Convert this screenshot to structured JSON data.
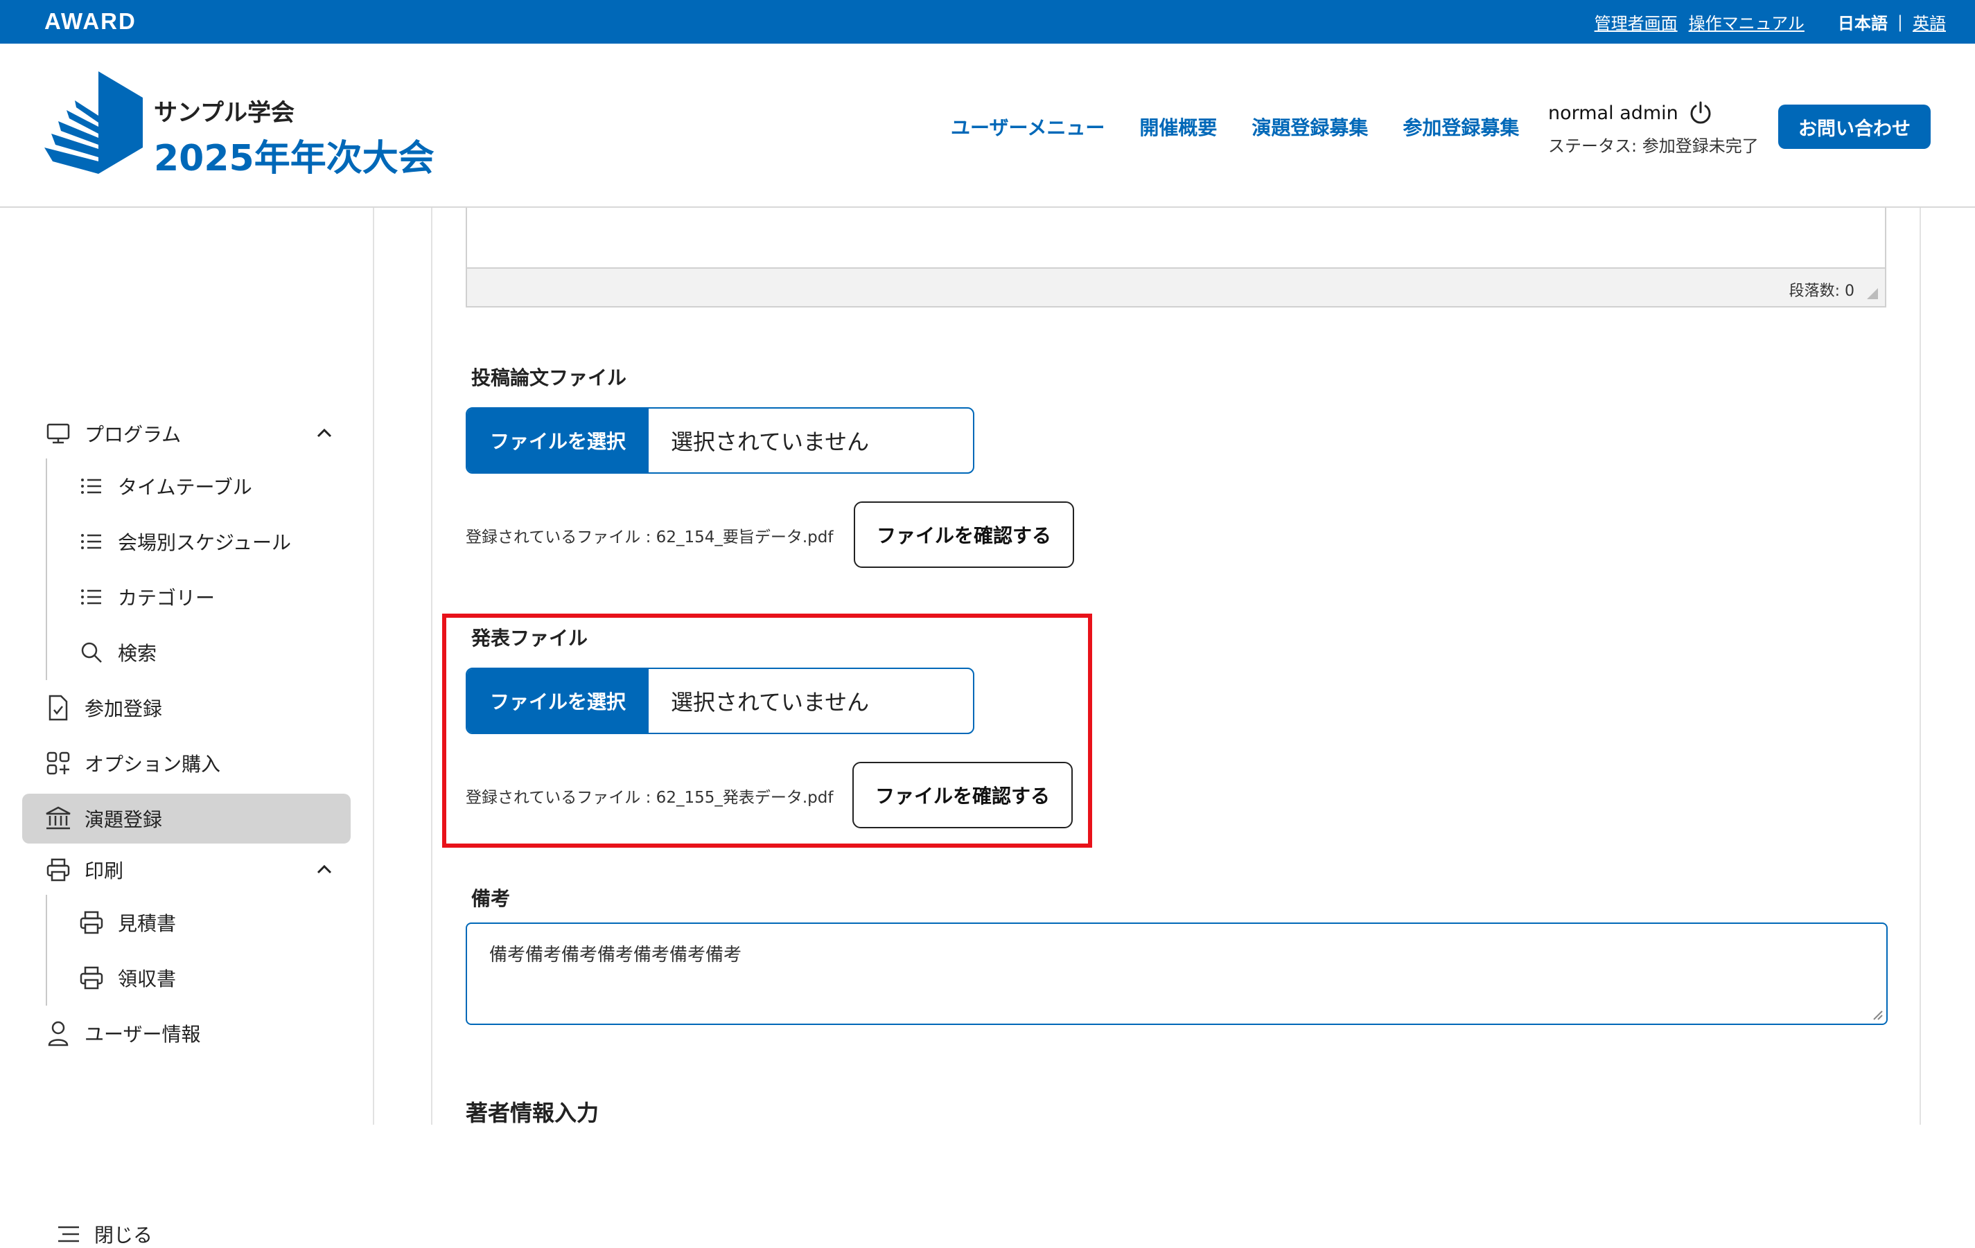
{
  "topbar": {
    "brand": "AWARD",
    "admin_link": "管理者画面",
    "manual_link": "操作マニュアル",
    "lang_current": "日本語",
    "lang_sep": "|",
    "lang_other": "英語"
  },
  "header": {
    "logo_line1": "サンプル学会",
    "logo_line2": "2025年年次大会",
    "nav": [
      "ユーザーメニュー",
      "開催概要",
      "演題登録募集",
      "参加登録募集"
    ],
    "user_name": "normal admin",
    "status": "ステータス: 参加登録未完了",
    "contact": "お問い合わせ"
  },
  "sidebar": {
    "program": "プログラム",
    "timetable": "タイムテーブル",
    "venue_schedule": "会場別スケジュール",
    "category": "カテゴリー",
    "search": "検索",
    "participation": "参加登録",
    "option": "オプション購入",
    "abstract": "演題登録",
    "print": "印刷",
    "estimate": "見積書",
    "receipt": "領収書",
    "user_info": "ユーザー情報",
    "close": "閉じる"
  },
  "main": {
    "paragraph_count": "段落数: 0",
    "paper_file": {
      "label": "投稿論文ファイル",
      "choose": "ファイルを選択",
      "none": "選択されていません",
      "registered": "登録されているファイル : 62_154_要旨データ.pdf",
      "confirm": "ファイルを確認する"
    },
    "presentation_file": {
      "label": "発表ファイル",
      "choose": "ファイルを選択",
      "none": "選択されていません",
      "registered": "登録されているファイル : 62_155_発表データ.pdf",
      "confirm": "ファイルを確認する"
    },
    "remarks_label": "備考",
    "remarks_value": "備考備考備考備考備考備考備考",
    "author_section": "著者情報入力"
  },
  "colors": {
    "brand_blue": "#0068b8",
    "highlight_red": "#e8121a",
    "active_bg": "#d3d3d3"
  }
}
